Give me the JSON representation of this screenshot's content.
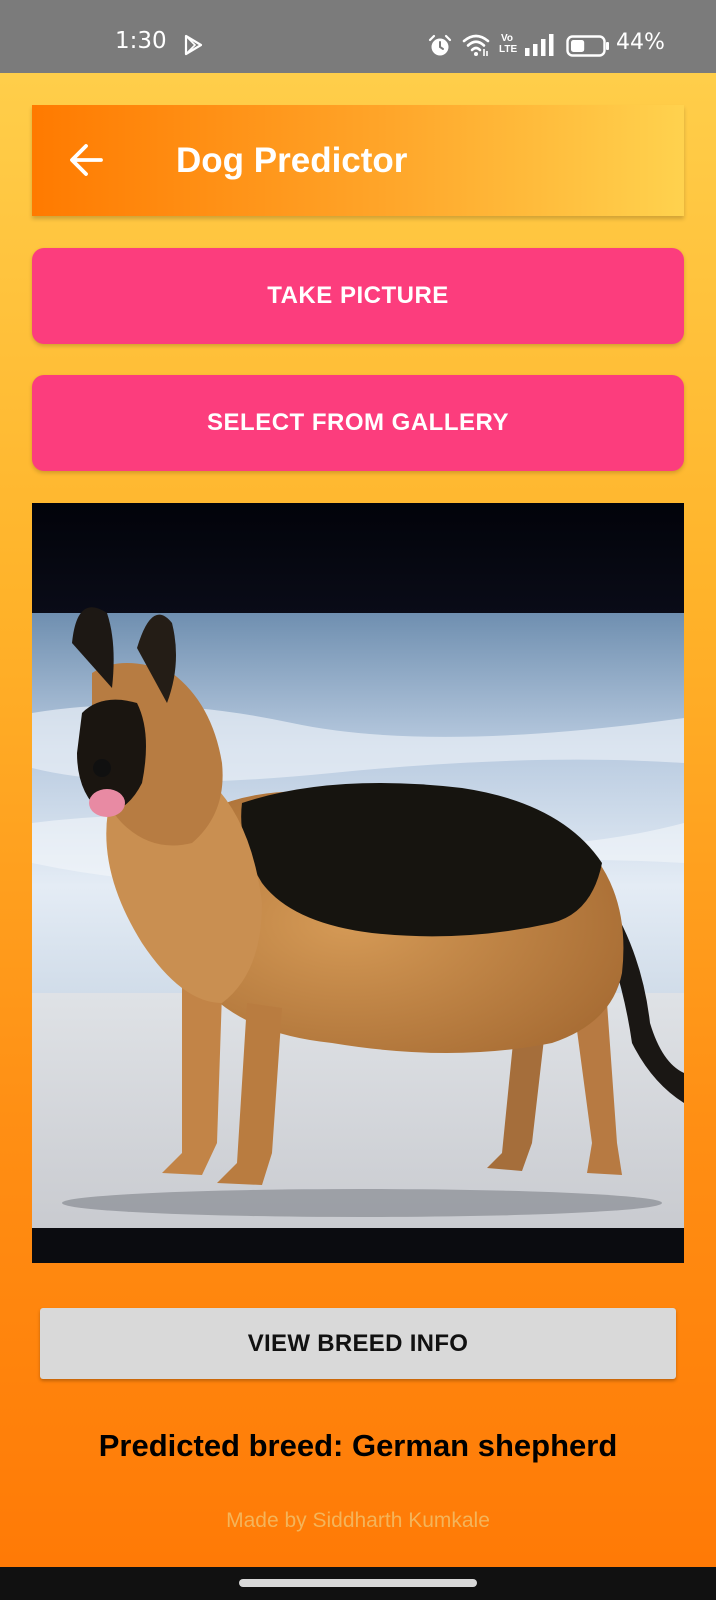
{
  "status_bar": {
    "time": "1:30",
    "volte_label_top": "Vo",
    "volte_label_bottom": "LTE",
    "battery_percent": "44%",
    "battery_level": 0.44,
    "icons": [
      "play-store-icon",
      "alarm-icon",
      "wifi-icon",
      "volte-icon",
      "signal-icon",
      "battery-icon"
    ]
  },
  "app_bar": {
    "title": "Dog Predictor",
    "back_icon": "arrow-left-icon"
  },
  "buttons": {
    "take_picture": "TAKE PICTURE",
    "select_gallery": "SELECT FROM GALLERY",
    "view_breed_info": "VIEW BREED INFO"
  },
  "result": {
    "predicted_text": "Predicted breed: German shepherd"
  },
  "footer": {
    "credit": "Made by Siddharth Kumkale"
  },
  "colors": {
    "status_bar": "#7b7b7b",
    "primary_button": "#fc3d7d",
    "secondary_button": "#d9d9d9",
    "gradient_top": "#ffce4a",
    "gradient_bottom": "#ff7a06"
  }
}
